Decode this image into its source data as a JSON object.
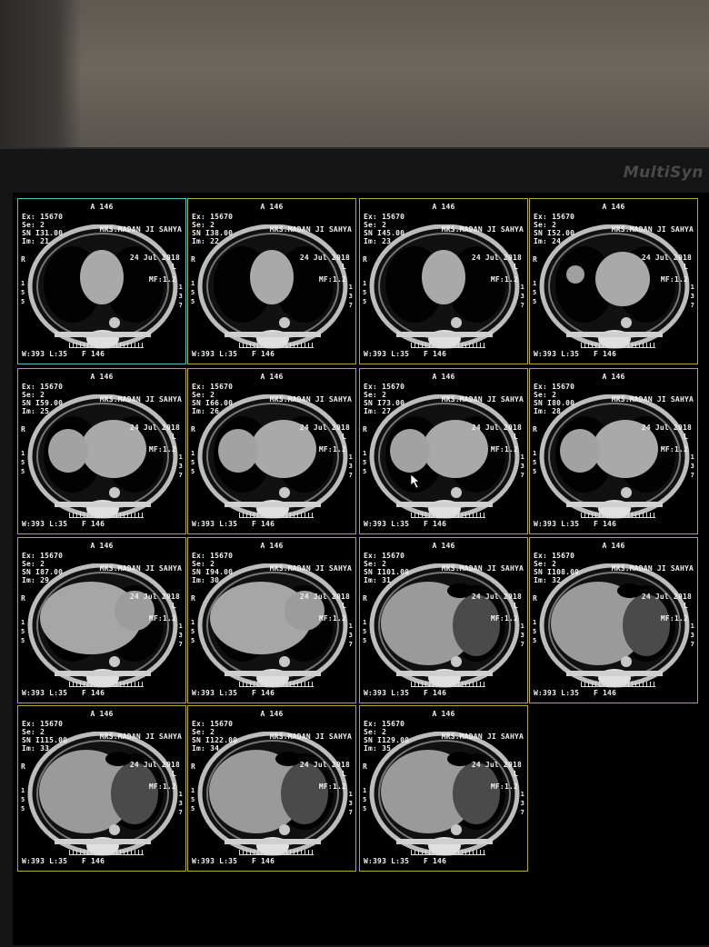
{
  "monitor": {
    "brand": "MultiSyn"
  },
  "viewer": {
    "rows": [
      [
        {
          "position": "A 146",
          "exam": "Ex: 15670",
          "series": "Se: 2",
          "slice": "SN I31.00",
          "image": "Im: 21",
          "patient": "MRS.MADAN JI SAHYA",
          "date": "24 Jul 2018",
          "side": "L",
          "magnify": "MF:1.2",
          "r": "R",
          "scale_r": "1\n5\n5",
          "scale_l": "1\n3\n7",
          "window": "W:393 L:35",
          "fp": "F 146",
          "selected": true,
          "organ": "heart-small"
        },
        {
          "position": "A 146",
          "exam": "Ex: 15670",
          "series": "Se: 2",
          "slice": "SN I38.00",
          "image": "Im: 22",
          "patient": "MRS.MADAN JI SAHYA",
          "date": "24 Jul 2018",
          "side": "L",
          "magnify": "MF:1.2",
          "r": "R",
          "scale_r": "1\n5\n5",
          "scale_l": "1\n3\n7",
          "window": "W:393 L:35",
          "fp": "F 146",
          "selected": false,
          "organ": "heart-small"
        },
        {
          "position": "A 146",
          "exam": "Ex: 15670",
          "series": "Se: 2",
          "slice": "SN I45.00",
          "image": "Im: 23",
          "patient": "MRS.MADAN JI SAHYA",
          "date": "24 Jul 2018",
          "side": "L",
          "magnify": "MF:1.2",
          "r": "R",
          "scale_r": "1\n5\n5",
          "scale_l": "1\n3\n7",
          "window": "W:393 L:35",
          "fp": "F 146",
          "selected": false,
          "organ": "heart-small"
        },
        {
          "position": "A 146",
          "exam": "Ex: 15670",
          "series": "Se: 2",
          "slice": "SN I52.00",
          "image": "Im: 24",
          "patient": "MRS.MADAN JI SAHYA",
          "date": "24 Jul 2018",
          "side": "L",
          "magnify": "MF:1.2",
          "r": "R",
          "scale_r": "1\n5\n5",
          "scale_l": "1\n3\n7",
          "window": "W:393 L:35",
          "fp": "F 146",
          "selected": false,
          "organ": "heart-mid"
        }
      ],
      [
        {
          "position": "A 146",
          "exam": "Ex: 15670",
          "series": "Se: 2",
          "slice": "SN I59.00",
          "image": "Im: 25",
          "patient": "MRS.MADAN JI SAHYA",
          "date": "24 Jul 2018",
          "side": "L",
          "magnify": "MF:1.2",
          "r": "R",
          "scale_r": "1\n5\n5",
          "scale_l": "1\n3\n7",
          "window": "W:393 L:35",
          "fp": "F 146",
          "selected": false,
          "organ": "heart-large"
        },
        {
          "position": "A 146",
          "exam": "Ex: 15670",
          "series": "Se: 2",
          "slice": "SN I66.00",
          "image": "Im: 26",
          "patient": "MRS.MADAN JI SAHYA",
          "date": "24 Jul 2018",
          "side": "L",
          "magnify": "MF:1.2",
          "r": "R",
          "scale_r": "1\n5\n5",
          "scale_l": "1\n3\n7",
          "window": "W:393 L:35",
          "fp": "F 146",
          "selected": false,
          "organ": "heart-large"
        },
        {
          "position": "A 146",
          "exam": "Ex: 15670",
          "series": "Se: 2",
          "slice": "SN I73.00",
          "image": "Im: 27",
          "patient": "MRS.MADAN JI SAHYA",
          "date": "24 Jul 2018",
          "side": "L",
          "magnify": "MF:1.2",
          "r": "R",
          "scale_r": "1\n5\n5",
          "scale_l": "1\n3\n7",
          "window": "W:393 L:35",
          "fp": "F 146",
          "selected": false,
          "organ": "heart-large",
          "cursor": true
        },
        {
          "position": "A 146",
          "exam": "Ex: 15670",
          "series": "Se: 2",
          "slice": "SN I80.00",
          "image": "Im: 28",
          "patient": "MRS.MADAN JI SAHYA",
          "date": "24 Jul 2018",
          "side": "L",
          "magnify": "MF:1.2",
          "r": "R",
          "scale_r": "1\n5\n5",
          "scale_l": "1\n3\n7",
          "window": "W:393 L:35",
          "fp": "F 146",
          "selected": false,
          "organ": "heart-large"
        }
      ],
      [
        {
          "position": "A 146",
          "exam": "Ex: 15670",
          "series": "Se: 2",
          "slice": "SN I87.00",
          "image": "Im: 29",
          "patient": "MRS.MADAN JI SAHYA",
          "date": "24 Jul 2018",
          "side": "L",
          "magnify": "MF:1.2",
          "r": "R",
          "scale_r": "1\n5\n5",
          "scale_l": "1\n3\n7",
          "window": "W:393 L:35",
          "fp": "F 146",
          "selected": false,
          "organ": "liver"
        },
        {
          "position": "A 146",
          "exam": "Ex: 15670",
          "series": "Se: 2",
          "slice": "SN I94.00",
          "image": "Im: 30",
          "patient": "MRS.MADAN JI SAHYA",
          "date": "24 Jul 2018",
          "side": "L",
          "magnify": "MF:1.2",
          "r": "R",
          "scale_r": "1\n5\n5",
          "scale_l": "1\n3\n7",
          "window": "W:393 L:35",
          "fp": "F 146",
          "selected": false,
          "organ": "liver"
        },
        {
          "position": "A 146",
          "exam": "Ex: 15670",
          "series": "Se: 2",
          "slice": "SN I101.00",
          "image": "Im: 31",
          "patient": "MRS.MADAN JI SAHYA",
          "date": "24 Jul 2018",
          "side": "L",
          "magnify": "MF:1.2",
          "r": "R",
          "scale_r": "1\n5\n5",
          "scale_l": "1\n3\n7",
          "window": "W:393 L:35",
          "fp": "F 146",
          "selected": false,
          "organ": "abdomen"
        },
        {
          "position": "A 146",
          "exam": "Ex: 15670",
          "series": "Se: 2",
          "slice": "SN I108.00",
          "image": "Im: 32",
          "patient": "MRS.MADAN JI SAHYA",
          "date": "24 Jul 2018",
          "side": "L",
          "magnify": "MF:1.2",
          "r": "R",
          "scale_r": "1\n5\n5",
          "scale_l": "1\n3\n7",
          "window": "W:393 L:35",
          "fp": "F 146",
          "selected": false,
          "organ": "abdomen"
        }
      ],
      [
        {
          "position": "A 146",
          "exam": "Ex: 15670",
          "series": "Se: 2",
          "slice": "SN I115.00",
          "image": "Im: 33",
          "patient": "MRS.MADAN JI SAHYA",
          "date": "24 Jul 2018",
          "side": "L",
          "magnify": "MF:1.2",
          "r": "R",
          "scale_r": "1\n5\n5",
          "scale_l": "1\n3\n7",
          "window": "W:393 L:35",
          "fp": "F 146",
          "selected": false,
          "organ": "abdomen"
        },
        {
          "position": "A 146",
          "exam": "Ex: 15670",
          "series": "Se: 2",
          "slice": "SN I122.00",
          "image": "Im: 34",
          "patient": "MRS.MADAN JI SAHYA",
          "date": "24 Jul 2018",
          "side": "L",
          "magnify": "MF:1.2",
          "r": "R",
          "scale_r": "1\n5\n5",
          "scale_l": "1\n3\n7",
          "window": "W:393 L:35",
          "fp": "F 146",
          "selected": false,
          "organ": "abdomen"
        },
        {
          "position": "A 146",
          "exam": "Ex: 15670",
          "series": "Se: 2",
          "slice": "SN I129.00",
          "image": "Im: 35",
          "patient": "MRS.MADAN JI SAHYA",
          "date": "24 Jul 2018",
          "side": "L",
          "magnify": "MF:1.2",
          "r": "R",
          "scale_r": "1\n5\n5",
          "scale_l": "1\n3\n7",
          "window": "W:393 L:35",
          "fp": "F 146",
          "selected": false,
          "organ": "abdomen"
        }
      ]
    ],
    "colors": {
      "frame": "#b8a92a",
      "selected": "#4fc2c6",
      "overlay_text": "#f2f2f2"
    }
  }
}
